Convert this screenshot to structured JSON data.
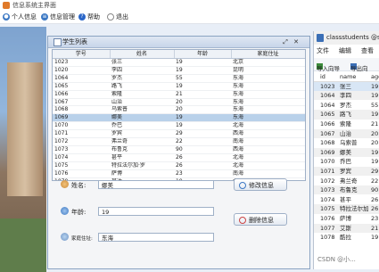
{
  "window": {
    "title": "信息系统主界面"
  },
  "menubar": {
    "items": [
      {
        "label": "个人信息",
        "icon": "person-icon",
        "color": "#3b78c4"
      },
      {
        "label": "信息管理",
        "icon": "list-icon",
        "color": "#3b78c4"
      },
      {
        "label": "帮助",
        "icon": "help-icon",
        "color": "#2a66c8"
      },
      {
        "label": "退出",
        "icon": "exit-icon",
        "color": "#888888"
      }
    ]
  },
  "student_frame": {
    "title": "学生列表",
    "columns": [
      "学号",
      "姓名",
      "年龄",
      "家庭住址"
    ],
    "rows": [
      [
        "1023",
        "张三",
        "19",
        "北京"
      ],
      [
        "1020",
        "李四",
        "19",
        "昆明"
      ],
      [
        "1064",
        "罗杰",
        "55",
        "东海"
      ],
      [
        "1065",
        "路飞",
        "19",
        "东海"
      ],
      [
        "1066",
        "索隆",
        "21",
        "东海"
      ],
      [
        "1067",
        "山治",
        "20",
        "东海"
      ],
      [
        "1068",
        "乌索普",
        "20",
        "东海"
      ],
      [
        "1069",
        "娜美",
        "19",
        "东海"
      ],
      [
        "1070",
        "乔巴",
        "19",
        "北海"
      ],
      [
        "1071",
        "罗宾",
        "29",
        "西海"
      ],
      [
        "1072",
        "弗兰奇",
        "22",
        "南海"
      ],
      [
        "1073",
        "布鲁克",
        "90",
        "西海"
      ],
      [
        "1074",
        "甚平",
        "26",
        "北海"
      ],
      [
        "1075",
        "特拉法尔加·罗",
        "26",
        "北海"
      ],
      [
        "1076",
        "萨博",
        "23",
        "南海"
      ],
      [
        "1070",
        "甚达",
        "19",
        "北海"
      ]
    ],
    "selected_row_index": 7,
    "form": {
      "name_label": "姓名:",
      "name_value": "娜美",
      "age_label": "年龄:",
      "age_value": "19",
      "address_label": "家庭住址:",
      "address_value": "东海",
      "update_button": "修改信息",
      "delete_button": "删除信息"
    }
  },
  "db_window": {
    "title": "classstudents @stu",
    "menu": [
      "文件",
      "编辑",
      "查看"
    ],
    "toolbar": [
      "导入向导",
      "导出向"
    ],
    "columns": [
      "id",
      "name",
      "age"
    ],
    "rows": [
      [
        "1023",
        "张三",
        "19"
      ],
      [
        "1064",
        "李四",
        "19"
      ],
      [
        "1064",
        "罗杰",
        "55"
      ],
      [
        "1065",
        "路飞",
        "19"
      ],
      [
        "1066",
        "索隆",
        "21"
      ],
      [
        "1067",
        "山治",
        "20"
      ],
      [
        "1068",
        "乌索普",
        "20"
      ],
      [
        "1069",
        "娜美",
        "19"
      ],
      [
        "1070",
        "乔巴",
        "19"
      ],
      [
        "1071",
        "罗宾",
        "29"
      ],
      [
        "1072",
        "弗兰奇",
        "22"
      ],
      [
        "1073",
        "布鲁克",
        "90"
      ],
      [
        "1074",
        "甚平",
        "26"
      ],
      [
        "1075",
        "特拉法尔加",
        "26"
      ],
      [
        "1076",
        "萨博",
        "23"
      ],
      [
        "1077",
        "艾斯",
        "21"
      ],
      [
        "1078",
        "酷拉",
        "19"
      ]
    ]
  },
  "watermark": "CSDN @小..."
}
